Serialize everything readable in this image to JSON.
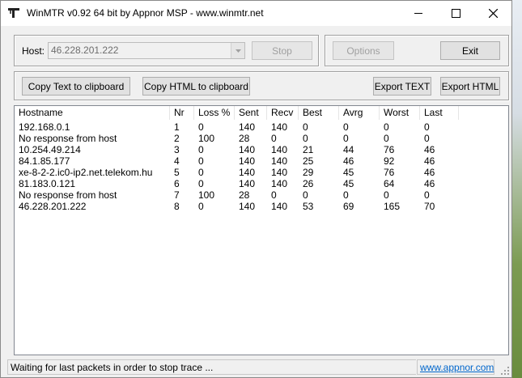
{
  "window": {
    "title": "WinMTR v0.92 64 bit by Appnor MSP - www.winmtr.net"
  },
  "host": {
    "label": "Host:",
    "value": "46.228.201.222"
  },
  "buttons": {
    "stop": "Stop",
    "options": "Options",
    "exit": "Exit",
    "copy_text": "Copy Text to clipboard",
    "copy_html": "Copy HTML to clipboard",
    "export_text": "Export TEXT",
    "export_html": "Export HTML"
  },
  "table": {
    "columns": [
      "Hostname",
      "Nr",
      "Loss %",
      "Sent",
      "Recv",
      "Best",
      "Avrg",
      "Worst",
      "Last"
    ],
    "rows": [
      [
        "192.168.0.1",
        "1",
        "0",
        "140",
        "140",
        "0",
        "0",
        "0",
        "0"
      ],
      [
        "No response from host",
        "2",
        "100",
        "28",
        "0",
        "0",
        "0",
        "0",
        "0"
      ],
      [
        "10.254.49.214",
        "3",
        "0",
        "140",
        "140",
        "21",
        "44",
        "76",
        "46"
      ],
      [
        "84.1.85.177",
        "4",
        "0",
        "140",
        "140",
        "25",
        "46",
        "92",
        "46"
      ],
      [
        "xe-8-2-2.ic0-ip2.net.telekom.hu",
        "5",
        "0",
        "140",
        "140",
        "29",
        "45",
        "76",
        "46"
      ],
      [
        "81.183.0.121",
        "6",
        "0",
        "140",
        "140",
        "26",
        "45",
        "64",
        "46"
      ],
      [
        "No response from host",
        "7",
        "100",
        "28",
        "0",
        "0",
        "0",
        "0",
        "0"
      ],
      [
        "46.228.201.222",
        "8",
        "0",
        "140",
        "140",
        "53",
        "69",
        "165",
        "70"
      ]
    ]
  },
  "status": {
    "message": "Waiting for last packets in order to stop trace ...",
    "link": "www.appnor.com"
  }
}
